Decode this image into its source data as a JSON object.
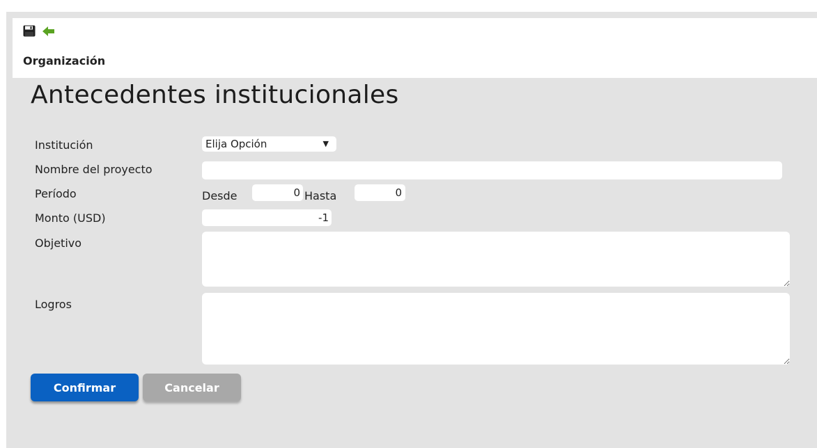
{
  "header": {
    "title": "Organización",
    "icons": [
      "save-icon",
      "back-arrow-icon"
    ]
  },
  "page_title": "Antecedentes institucionales",
  "form": {
    "institucion": {
      "label": "Institución",
      "selected": "Elija Opción"
    },
    "nombre_proyecto": {
      "label": "Nombre del proyecto",
      "value": ""
    },
    "periodo": {
      "label": "Período",
      "desde_label": "Desde",
      "desde_value": "0",
      "hasta_label": "Hasta",
      "hasta_value": "0"
    },
    "monto": {
      "label": "Monto (USD)",
      "value": "-1"
    },
    "objetivo": {
      "label": "Objetivo",
      "value": ""
    },
    "logros": {
      "label": "Logros",
      "value": ""
    }
  },
  "buttons": {
    "confirm": "Confirmar",
    "cancel": "Cancelar"
  },
  "colors": {
    "background": "#e3e3e3",
    "confirm_button": "#0a61c2",
    "cancel_button": "#a8a8a8",
    "back_icon": "#5aa322"
  }
}
